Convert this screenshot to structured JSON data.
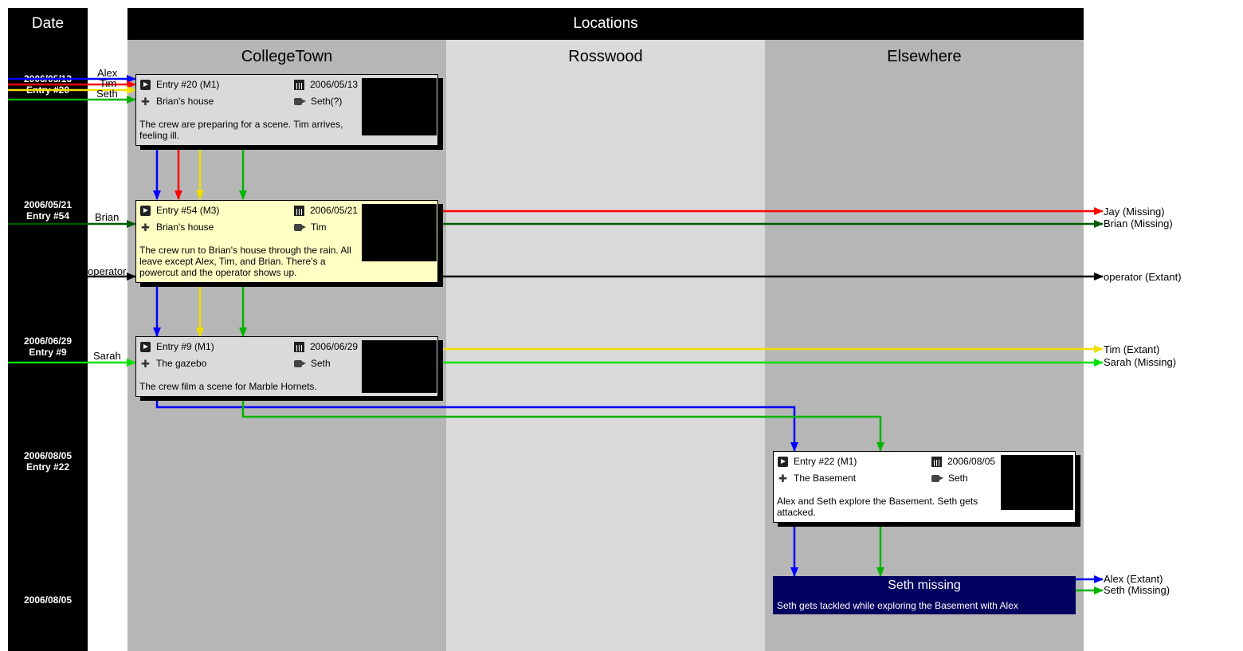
{
  "header": {
    "date": "Date",
    "locations": "Locations"
  },
  "columns": [
    "CollegeTown",
    "Rosswood",
    "Elsewhere"
  ],
  "dates": [
    {
      "date": "2006/05/13",
      "entry": "Entry #20"
    },
    {
      "date": "2006/05/21",
      "entry": "Entry #54"
    },
    {
      "date": "2006/06/29",
      "entry": "Entry #9"
    },
    {
      "date": "2006/08/05",
      "entry": "Entry #22"
    },
    {
      "date": "2006/08/05",
      "entry": ""
    }
  ],
  "start_labels": [
    "Alex",
    "Tim",
    "Seth",
    "Brian",
    "operator",
    "Sarah"
  ],
  "end_labels": [
    "Jay (Missing)",
    "Brian (Missing)",
    "operator (Extant)",
    "Tim (Extant)",
    "Sarah (Missing)",
    "Alex (Extant)",
    "Seth (Missing)"
  ],
  "cards": [
    {
      "title": "Entry #20 (M1)",
      "date": "2006/05/13",
      "location": "Brian's house",
      "camera": "Seth(?)",
      "description": "The crew are preparing for a scene.  Tim arrives, feeling ill."
    },
    {
      "title": "Entry #54 (M3)",
      "date": "2006/05/21",
      "location": "Brian's house",
      "camera": "Tim",
      "description": "The crew run to Brian's house through the rain.  All leave except Alex, Tim, and Brian.  There's a powercut and the operator shows up."
    },
    {
      "title": "Entry #9 (M1)",
      "date": "2006/06/29",
      "location": "The gazebo",
      "camera": "Seth",
      "description": "The crew film a scene for Marble Hornets."
    },
    {
      "title": "Entry #22 (M1)",
      "date": "2006/08/05",
      "location": "The Basement",
      "camera": "Seth",
      "description": "Alex and Seth explore the Basement.  Seth gets attacked."
    }
  ],
  "event": {
    "title": "Seth missing",
    "description": "Seth gets tackled while exploring the Basement with Alex"
  },
  "colors": {
    "date_column": "#000000",
    "header": "#000000",
    "col_collegetown": "#b6b6b6",
    "col_rosswood": "#dadada",
    "col_elsewhere": "#b6b6b6",
    "card_default": "#dadada",
    "card_highlight": "#ffffc4",
    "card_22": "#ffffff",
    "event": "#00005f",
    "Alex": "#0000ff",
    "Jay": "#ff0000",
    "Tim": "#f0e000",
    "Seth": "#00b400",
    "Brian": "#005a00",
    "operator": "#000000",
    "Sarah": "#00e000"
  }
}
